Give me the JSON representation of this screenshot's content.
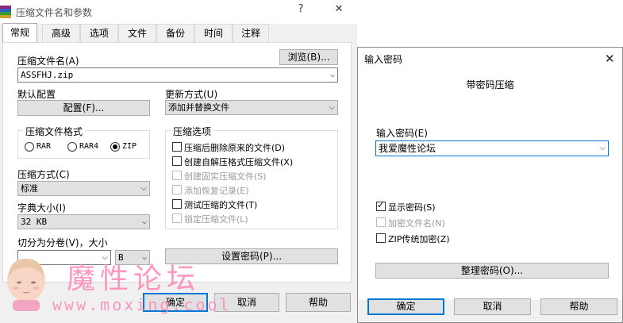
{
  "main": {
    "title": "压缩文件名和参数",
    "help_btn": "?",
    "close_btn": "✕",
    "tabs": [
      "常规",
      "高级",
      "选项",
      "文件",
      "备份",
      "时间",
      "注释"
    ],
    "archive_name_label": "压缩文件名(A)",
    "browse_btn": "浏览(B)...",
    "archive_name_value": "ASSFHJ.zip",
    "default_profile_label": "默认配置",
    "profile_btn": "配置(F)...",
    "update_mode_label": "更新方式(U)",
    "update_mode_value": "添加并替换文件",
    "format_group_label": "压缩文件格式",
    "formats": [
      "RAR",
      "RAR4",
      "ZIP"
    ],
    "selected_format": "ZIP",
    "options_group_label": "压缩选项",
    "options": [
      {
        "label": "压缩后删除原来的文件(D)",
        "checked": false,
        "enabled": true
      },
      {
        "label": "创建自解压格式压缩文件(X)",
        "checked": false,
        "enabled": true
      },
      {
        "label": "创建固实压缩文件(S)",
        "checked": false,
        "enabled": false
      },
      {
        "label": "添加恢复记录(E)",
        "checked": false,
        "enabled": false
      },
      {
        "label": "测试压缩的文件(T)",
        "checked": false,
        "enabled": true
      },
      {
        "label": "锁定压缩文件(L)",
        "checked": false,
        "enabled": false
      }
    ],
    "method_label": "压缩方式(C)",
    "method_value": "标准",
    "dict_label": "字典大小(I)",
    "dict_value": "32 KB",
    "split_label": "切分为分卷(V)，大小",
    "split_value": "",
    "split_unit": "B",
    "set_password_btn": "设置密码(P)...",
    "ok_btn": "确定",
    "cancel_btn": "取消",
    "help_button": "帮助"
  },
  "password_dialog": {
    "title": "输入密码",
    "close_btn": "✕",
    "heading": "带密码压缩",
    "password_label": "输入密码(E)",
    "password_value": "我爱魔性论坛",
    "show_password_label": "显示密码(S)",
    "show_password_checked": true,
    "encrypt_names_label": "加密文件名(N)",
    "encrypt_names_enabled": false,
    "zip_legacy_label": "ZIP传统加密(Z)",
    "zip_legacy_checked": false,
    "organize_btn": "整理密码(O)...",
    "ok_btn": "确定",
    "cancel_btn": "取消",
    "help_btn": "帮助"
  },
  "watermark": {
    "chinese": "魔性论坛",
    "url": "www.moxing.cool"
  }
}
